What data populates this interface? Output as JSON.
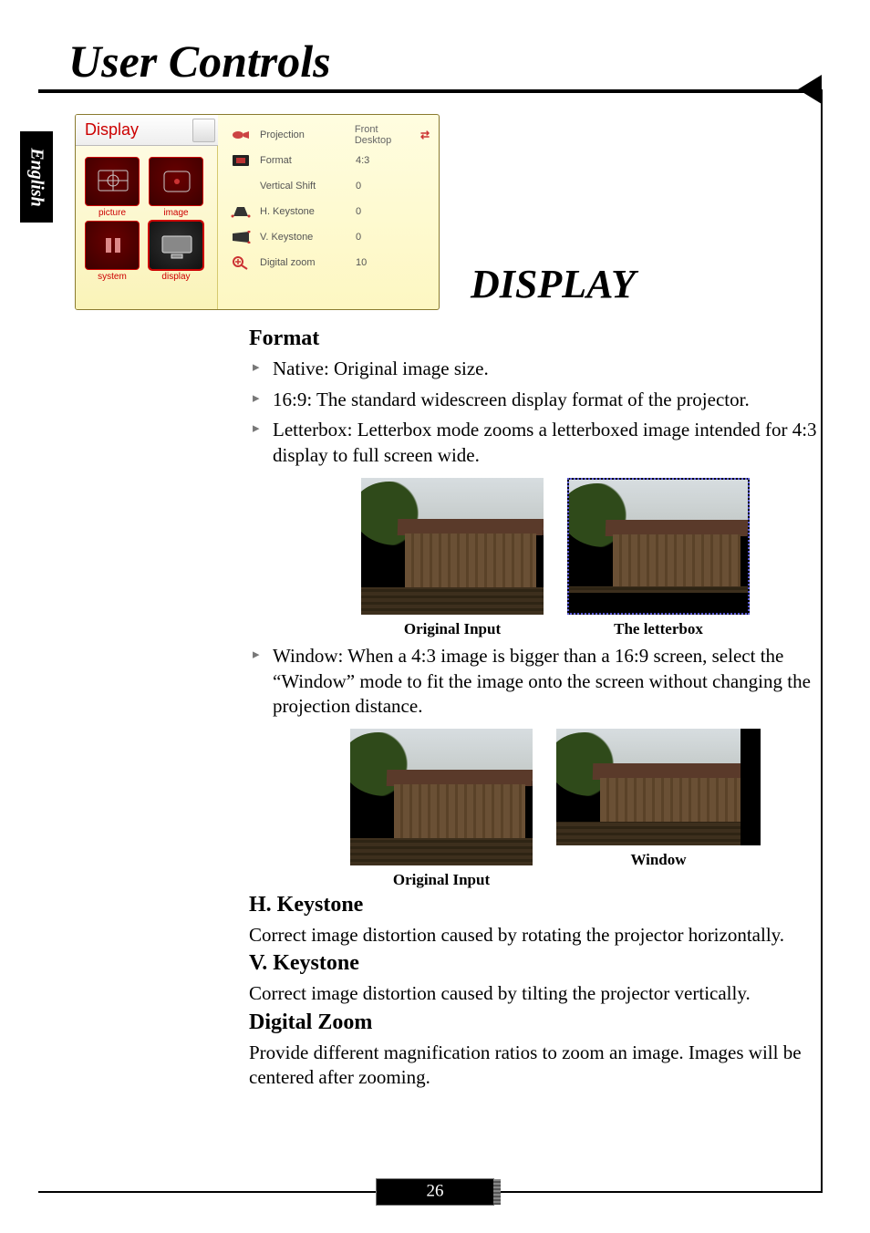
{
  "lang_tab": "English",
  "header_title": "User Controls",
  "display_heading": "DISPLAY",
  "page_number": "26",
  "osd": {
    "title": "Display",
    "left_tabs": [
      {
        "key": "picture",
        "label": "picture"
      },
      {
        "key": "image",
        "label": "image"
      },
      {
        "key": "system",
        "label": "system"
      },
      {
        "key": "display",
        "label": "display"
      }
    ],
    "rows": {
      "projection": {
        "label": "Projection",
        "value": "Front Desktop"
      },
      "format": {
        "label": "Format",
        "value": "4:3"
      },
      "vshift": {
        "label": "Vertical Shift",
        "value": "0"
      },
      "hkey": {
        "label": "H. Keystone",
        "value": "0"
      },
      "vkey": {
        "label": "V. Keystone",
        "value": "0"
      },
      "dzoom": {
        "label": "Digital zoom",
        "value": "10"
      }
    }
  },
  "sections": {
    "format": {
      "title": "Format",
      "items": {
        "native": "Native: Original image size.",
        "wide": "16:9: The standard widescreen display format of the projector.",
        "letterbox": "Letterbox: Letterbox mode zooms a letterboxed image intended for 4:3 display to full screen wide.",
        "window": "Window: When a 4:3 image is bigger than a 16:9 screen, select the “Window” mode to fit the image onto the screen without changing the projection distance."
      },
      "captions": {
        "orig1": "Original Input",
        "letterbox": "The letterbox",
        "orig2": "Original Input",
        "window": "Window"
      }
    },
    "hkey": {
      "title": "H. Keystone",
      "text": "Correct image distortion caused by rotating the projector horizontally."
    },
    "vkey": {
      "title": "V. Keystone",
      "text": "Correct image distortion caused by tilting the projector vertically."
    },
    "dzoom": {
      "title": "Digital Zoom",
      "text": "Provide different magnification ratios to zoom an image. Images will be centered after zooming."
    }
  }
}
